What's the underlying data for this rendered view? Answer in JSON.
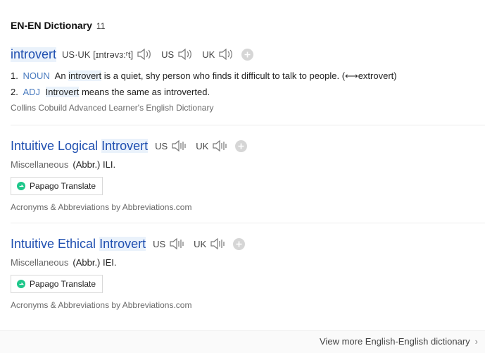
{
  "header": {
    "title": "EN-EN Dictionary",
    "count": "11"
  },
  "entries": [
    {
      "word": "introvert",
      "pron": "US·UK [ɪntrəvɜ:ʳt]",
      "us": "US",
      "uk": "UK",
      "defs": [
        {
          "num": "1.",
          "pos": "NOUN",
          "text_a": "An",
          "hl": "introvert",
          "text_b": "is a quiet, shy person who finds it difficult to talk to people. (⟷extrovert)"
        },
        {
          "num": "2.",
          "pos": "ADJ",
          "hl": "Introvert",
          "text_b": "means the same as introverted."
        }
      ],
      "source": "Collins Cobuild Advanced Learner's English Dictionary"
    },
    {
      "word_a": "Intuitive Logical",
      "word_hl": "Introvert",
      "us": "US",
      "uk": "UK",
      "category": "Miscellaneous",
      "abbr": "(Abbr.) ILI.",
      "papago": "Papago Translate",
      "source": "Acronyms & Abbreviations by Abbreviations.com"
    },
    {
      "word_a": "Intuitive Ethical",
      "word_hl": "Introvert",
      "us": "US",
      "uk": "UK",
      "category": "Miscellaneous",
      "abbr": "(Abbr.) IEI.",
      "papago": "Papago Translate",
      "source": "Acronyms & Abbreviations by Abbreviations.com"
    }
  ],
  "footer": {
    "more": "View more English-English dictionary",
    "chevron": "›"
  },
  "icons": {
    "speaker": "speaker-icon",
    "add": "plus-icon",
    "papago": "papago-icon"
  },
  "colors": {
    "link": "#1f4fb0",
    "highlight": "#eaf2fb",
    "pos": "#4a7bbf"
  }
}
